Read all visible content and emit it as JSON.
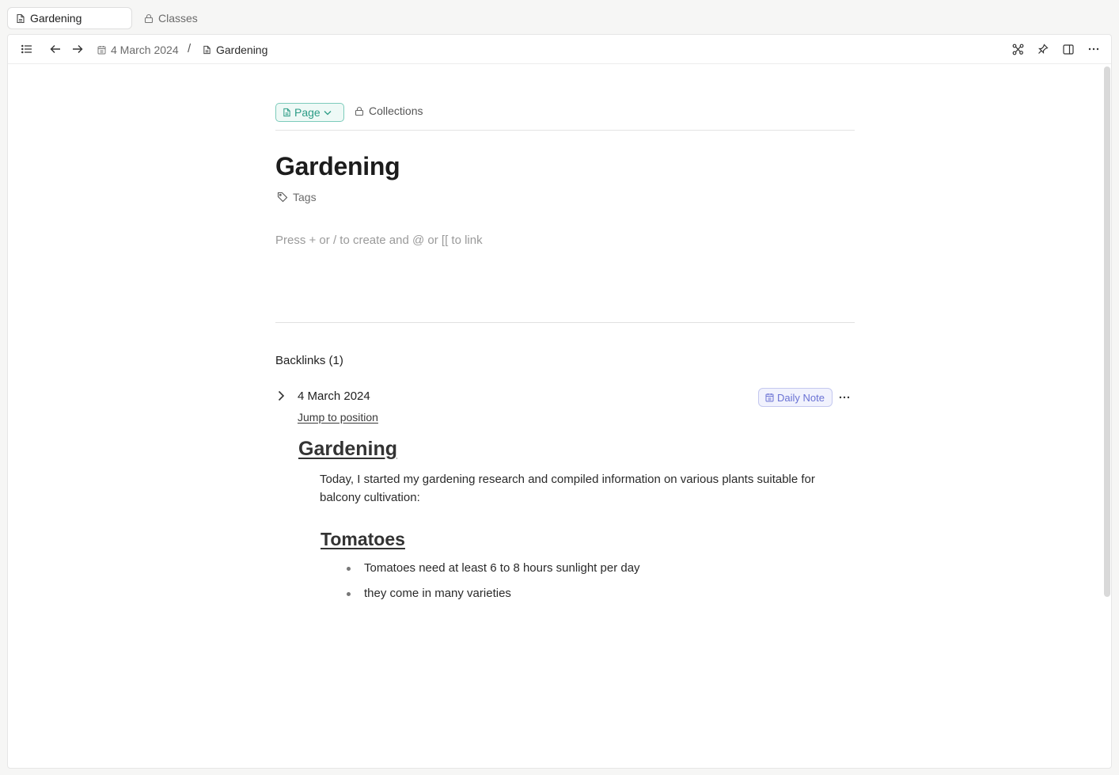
{
  "tabs": [
    {
      "label": "Gardening",
      "icon": "page-icon",
      "active": true
    },
    {
      "label": "Classes",
      "icon": "lock-icon",
      "active": false
    }
  ],
  "toolbar": {
    "breadcrumb": [
      {
        "label": "4 March 2024",
        "icon": "calendar-icon"
      },
      {
        "label": "Gardening",
        "icon": "page-icon"
      }
    ],
    "separator": "/"
  },
  "page": {
    "type_label": "Page",
    "collections_label": "Collections",
    "title": "Gardening",
    "tags_label": "Tags",
    "placeholder": "Press + or / to create and @ or [[ to link"
  },
  "backlinks": {
    "header": "Backlinks (1)",
    "items": [
      {
        "title": "4 March 2024",
        "badge": "Daily Note",
        "jump_label": "Jump to position",
        "heading": "Gardening",
        "paragraph": "Today, I started my gardening research and compiled information on various plants suitable for balcony cultivation:",
        "subheading": "Tomatoes",
        "bullets": [
          "Tomatoes need at least 6 to 8 hours sunlight per day",
          "they come in many varieties"
        ]
      }
    ]
  },
  "colors": {
    "accent_page": "#2c9c86",
    "accent_daily_note": "#6a72d4"
  }
}
